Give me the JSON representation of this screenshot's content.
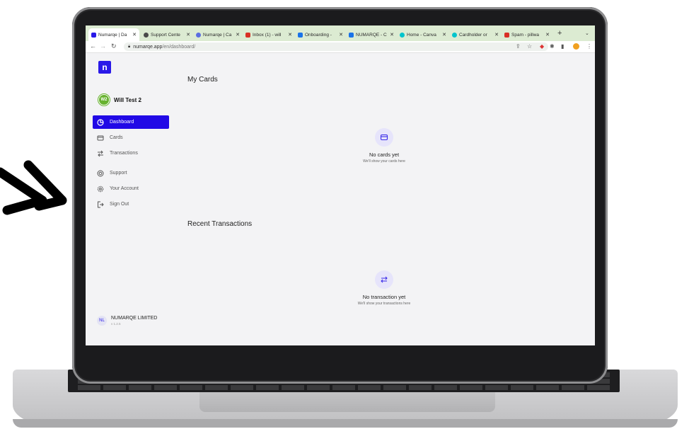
{
  "browser": {
    "tabs": [
      {
        "label": "Numarqe | Da",
        "color": "#2a19e8",
        "active": true
      },
      {
        "label": "Support Cente",
        "color": "#4a4a4a",
        "active": false
      },
      {
        "label": "Numarqe | Ca",
        "color": "#5b6ee1",
        "active": false
      },
      {
        "label": "Inbox (1) - will",
        "color": "#d93025",
        "active": false
      },
      {
        "label": "Onboarding -",
        "color": "#1a73e8",
        "active": false
      },
      {
        "label": "NUMARQE - C",
        "color": "#1a73e8",
        "active": false
      },
      {
        "label": "Home - Canva",
        "color": "#00c4cc",
        "active": false
      },
      {
        "label": "Cardholder or",
        "color": "#00c4cc",
        "active": false
      },
      {
        "label": "Spam - pillwa",
        "color": "#d93025",
        "active": false
      }
    ],
    "url_host": "numarqe.app",
    "url_path": "/en/dashboard/"
  },
  "sidebar": {
    "user_initials": "W2",
    "user_name": "Will Test 2",
    "nav": [
      {
        "label": "Dashboard",
        "icon": "pie-chart-icon",
        "active": true
      },
      {
        "label": "Cards",
        "icon": "credit-card-icon",
        "active": false
      },
      {
        "label": "Transactions",
        "icon": "transfer-icon",
        "active": false
      },
      {
        "label": "Support",
        "icon": "lifebuoy-icon",
        "active": false
      },
      {
        "label": "Your Account",
        "icon": "gear-icon",
        "active": false
      },
      {
        "label": "Sign Out",
        "icon": "sign-out-icon",
        "active": false
      }
    ],
    "org_initials": "NL",
    "org_name": "NUMARQE LIMITED",
    "org_version": "v 1.2.5"
  },
  "main": {
    "cards_title": "My Cards",
    "cards_empty_title": "No cards yet",
    "cards_empty_sub": "We'll show your cards here",
    "tx_title": "Recent Transactions",
    "tx_empty_title": "No transaction yet",
    "tx_empty_sub": "We'll show your transactions here"
  },
  "colors": {
    "brand": "#2109e6",
    "accent_soft": "#e6e4fb",
    "avatar_green": "#67b22f"
  }
}
